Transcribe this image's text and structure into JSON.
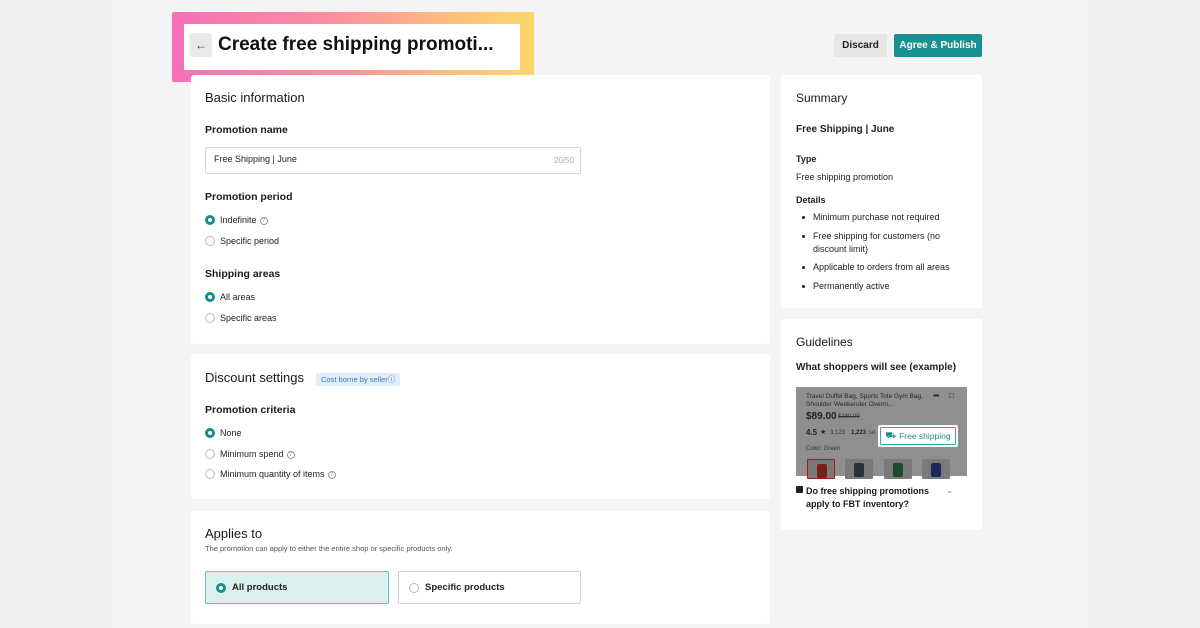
{
  "header": {
    "title": "Create free shipping promoti...",
    "back_icon": "arrow-left-icon",
    "discard_label": "Discard",
    "publish_label": "Agree & Publish",
    "accent_color": "#199191",
    "highlight_gradient": [
      "#f76fb8",
      "#fcc27a",
      "#fbd86a"
    ]
  },
  "basic": {
    "heading": "Basic information",
    "name_label": "Promotion name",
    "name_value": "Free Shipping | June",
    "name_counter": "20/50",
    "period_label": "Promotion period",
    "period_options": [
      {
        "label": "Indefinite",
        "selected": true,
        "help": true
      },
      {
        "label": "Specific period",
        "selected": false
      }
    ],
    "areas_label": "Shipping areas",
    "areas_options": [
      {
        "label": "All areas",
        "selected": true
      },
      {
        "label": "Specific areas",
        "selected": false
      }
    ]
  },
  "discount": {
    "heading": "Discount settings",
    "badge": "Cost borne by seller",
    "criteria_label": "Promotion criteria",
    "criteria_options": [
      {
        "label": "None",
        "selected": true
      },
      {
        "label": "Minimum spend",
        "selected": false,
        "help": true
      },
      {
        "label": "Minimum quantity of items",
        "selected": false,
        "help": true
      }
    ]
  },
  "applies": {
    "heading": "Applies to",
    "description": "The promotion can apply to either the entire shop or specific products only.",
    "options": [
      {
        "label": "All products",
        "selected": true
      },
      {
        "label": "Specific products",
        "selected": false
      }
    ]
  },
  "summary": {
    "heading": "Summary",
    "promo_name": "Free Shipping | June",
    "type_label": "Type",
    "type_value": "Free shipping promotion",
    "details_label": "Details",
    "details": [
      "Minimum purchase not required",
      "Free shipping for customers (no discount limit)",
      "Applicable to orders from all areas",
      "Permanently active"
    ]
  },
  "guidelines": {
    "heading": "Guidelines",
    "subheading": "What shoppers will see (example)",
    "preview": {
      "product_title": "Travel Duffel Bag, Sports Tote Gym Bag, Shoulder Weekender Overni...",
      "price": "$89.00",
      "original_price": "$180.00",
      "rating": "4.5",
      "reviews": "3,123",
      "sold": "1,223",
      "sold_suffix": "so",
      "free_shipping_label": "Free shipping",
      "color_label": "Color: Green"
    },
    "faq_question": "Do free shipping promotions apply to FBT inventory?"
  }
}
